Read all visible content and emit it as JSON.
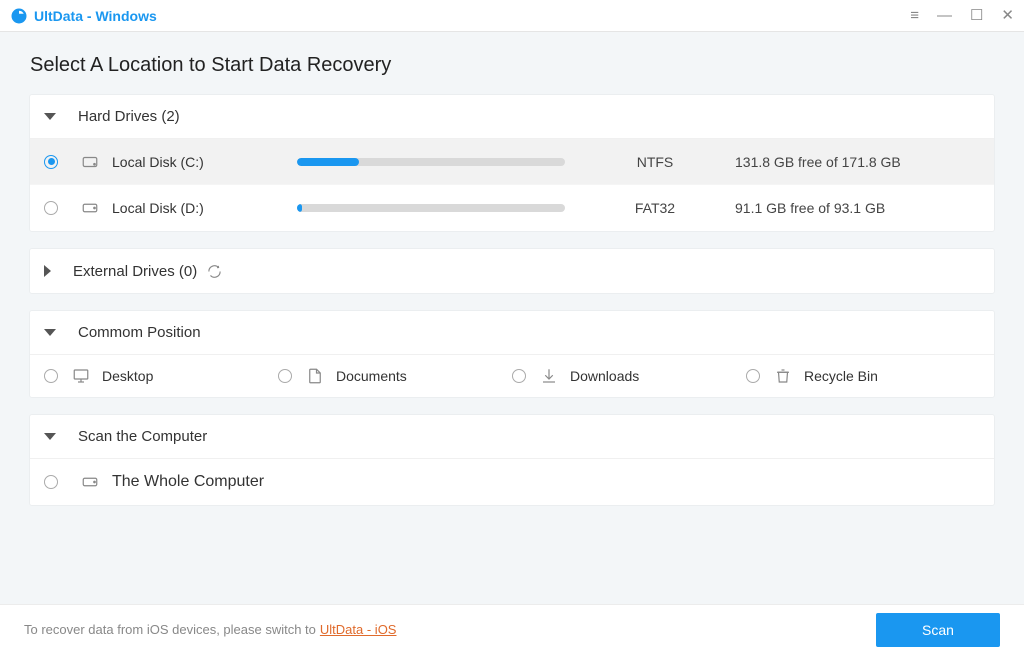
{
  "window": {
    "title": "UltData - Windows"
  },
  "page": {
    "heading": "Select A Location to Start Data Recovery"
  },
  "sections": {
    "hard_drives": {
      "title": "Hard Drives (2)"
    },
    "external_drives": {
      "title": "External Drives (0)"
    },
    "common": {
      "title": "Commom Position"
    },
    "scan_computer": {
      "title": "Scan the Computer"
    }
  },
  "drives": [
    {
      "name": "Local Disk (C:)",
      "fs": "NTFS",
      "free_text": "131.8 GB free of 171.8 GB",
      "used_pct": 23,
      "selected": true
    },
    {
      "name": "Local Disk (D:)",
      "fs": "FAT32",
      "free_text": "91.1 GB free of 93.1 GB",
      "used_pct": 2,
      "selected": false
    }
  ],
  "common_positions": [
    {
      "label": "Desktop",
      "icon": "desktop-icon"
    },
    {
      "label": "Documents",
      "icon": "document-icon"
    },
    {
      "label": "Downloads",
      "icon": "download-icon"
    },
    {
      "label": "Recycle Bin",
      "icon": "recycle-bin-icon"
    }
  ],
  "scan_item": {
    "label": "The Whole Computer"
  },
  "footer": {
    "prompt": "To recover data from iOS devices, please switch to",
    "link_text": "UltData - iOS",
    "scan_label": "Scan"
  },
  "colors": {
    "accent": "#1a97f0",
    "link": "#e06a2b"
  }
}
